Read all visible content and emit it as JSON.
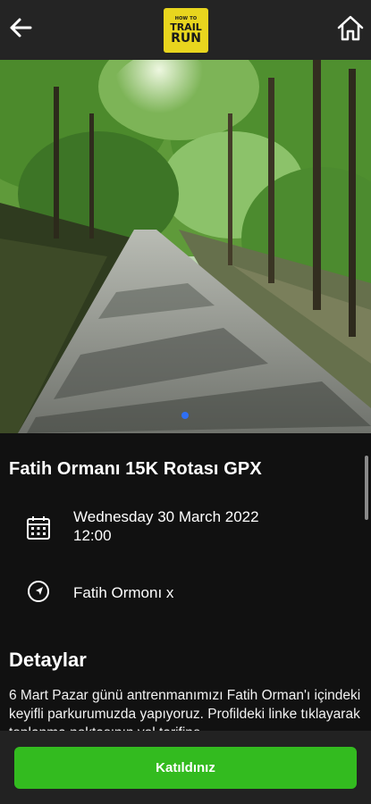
{
  "header": {
    "back_icon": "arrow-left-icon",
    "home_icon": "home-icon",
    "logo": {
      "line1": "HOW TO",
      "line2": "TRAIL",
      "line3": "RUN",
      "color": "#e8d51e"
    }
  },
  "hero": {
    "image": "forest-trail-photo",
    "active_slide": 1,
    "total_slides": 1,
    "dot_color": "#2f6ff5"
  },
  "event": {
    "title": "Fatih Ormanı 15K Rotası GPX",
    "date_icon": "calendar-icon",
    "date": "Wednesday 30 March 2022",
    "time": "12:00",
    "location_icon": "navigation-arrow-icon",
    "location": "Fatih Ormonı x"
  },
  "details": {
    "heading": "Detaylar",
    "text": "6 Mart Pazar günü antrenmanımızı Fatih Orman'ı içindeki keyifli parkurumuzda yapıyoruz. Profildeki linke tıklayarak toplanma noktasının yol tarifine"
  },
  "actions": {
    "join_label": "Katıldınız",
    "join_color": "#33bb1f"
  }
}
